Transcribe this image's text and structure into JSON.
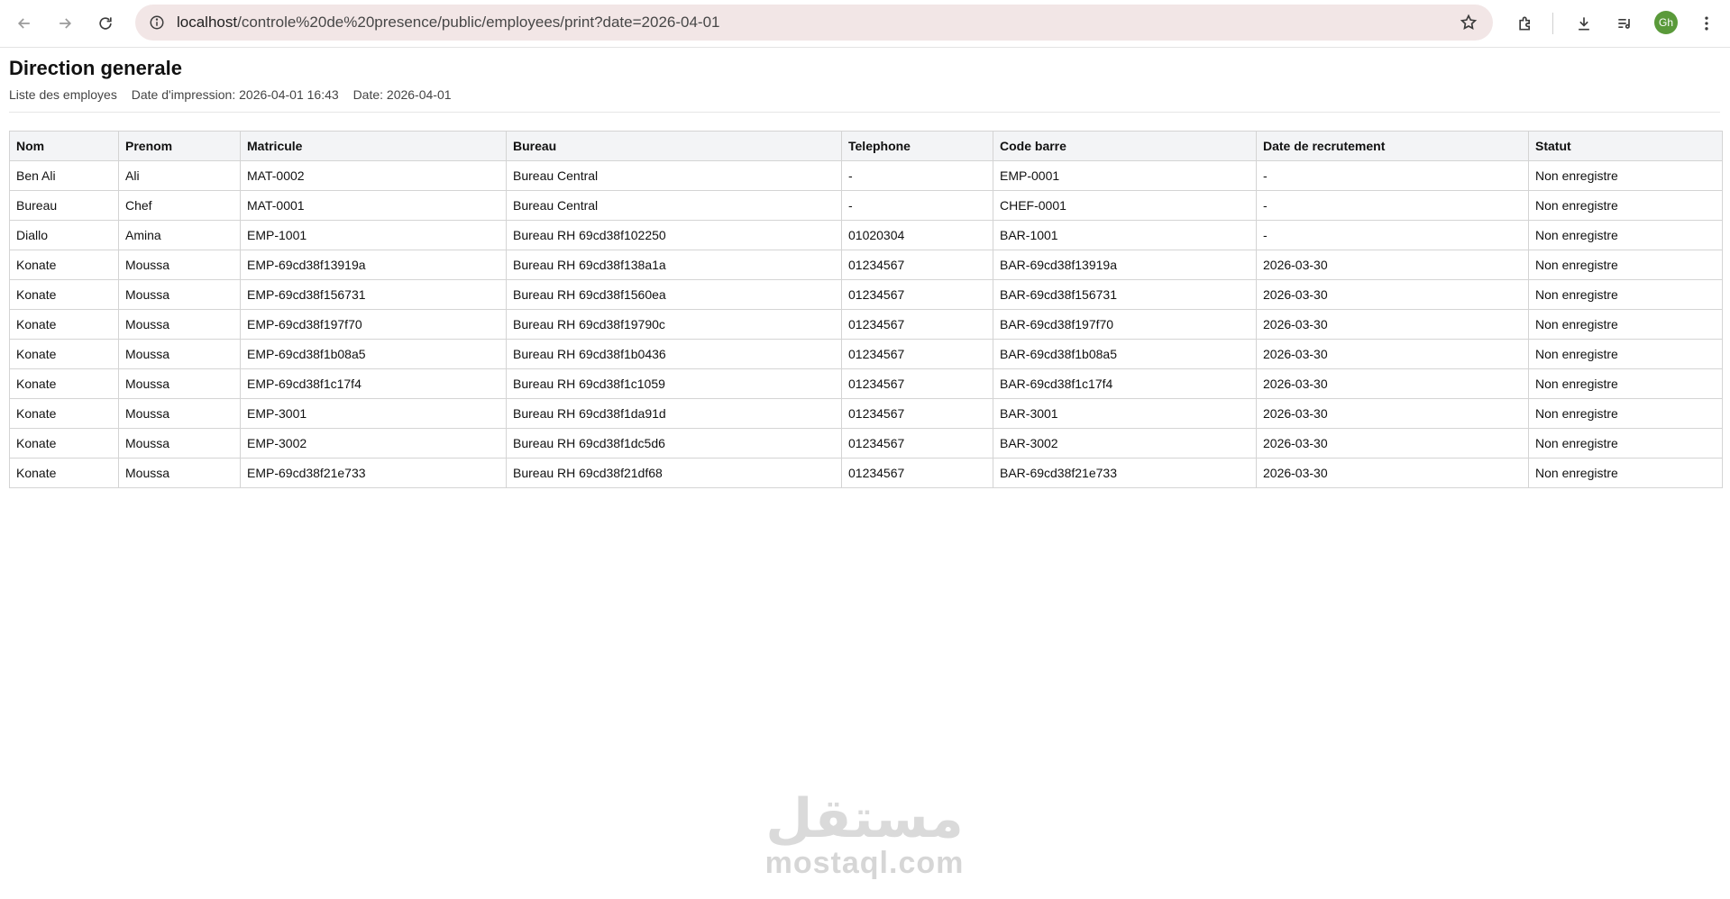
{
  "browser": {
    "url_host": "localhost",
    "url_path": "/controle%20de%20presence/public/employees/print?date=2026-04-01",
    "profile_initials": "Gh",
    "icons": [
      "back-icon",
      "forward-icon",
      "reload-icon",
      "site-info-icon",
      "star-icon",
      "extensions-icon",
      "download-icon",
      "media-icon",
      "menu-icon"
    ]
  },
  "page": {
    "title": "Direction generale",
    "subtitle": "Liste des employes",
    "printed_at": "Date d'impression: 2026-04-01 16:43",
    "date": "Date: 2026-04-01"
  },
  "table": {
    "columns": [
      "Nom",
      "Prenom",
      "Matricule",
      "Bureau",
      "Telephone",
      "Code barre",
      "Date de recrutement",
      "Statut"
    ],
    "rows": [
      [
        "Ben Ali",
        "Ali",
        "MAT-0002",
        "Bureau Central",
        "-",
        "EMP-0001",
        "-",
        "Non enregistre"
      ],
      [
        "Bureau",
        "Chef",
        "MAT-0001",
        "Bureau Central",
        "-",
        "CHEF-0001",
        "-",
        "Non enregistre"
      ],
      [
        "Diallo",
        "Amina",
        "EMP-1001",
        "Bureau RH 69cd38f102250",
        "01020304",
        "BAR-1001",
        "-",
        "Non enregistre"
      ],
      [
        "Konate",
        "Moussa",
        "EMP-69cd38f13919a",
        "Bureau RH 69cd38f138a1a",
        "01234567",
        "BAR-69cd38f13919a",
        "2026-03-30",
        "Non enregistre"
      ],
      [
        "Konate",
        "Moussa",
        "EMP-69cd38f156731",
        "Bureau RH 69cd38f1560ea",
        "01234567",
        "BAR-69cd38f156731",
        "2026-03-30",
        "Non enregistre"
      ],
      [
        "Konate",
        "Moussa",
        "EMP-69cd38f197f70",
        "Bureau RH 69cd38f19790c",
        "01234567",
        "BAR-69cd38f197f70",
        "2026-03-30",
        "Non enregistre"
      ],
      [
        "Konate",
        "Moussa",
        "EMP-69cd38f1b08a5",
        "Bureau RH 69cd38f1b0436",
        "01234567",
        "BAR-69cd38f1b08a5",
        "2026-03-30",
        "Non enregistre"
      ],
      [
        "Konate",
        "Moussa",
        "EMP-69cd38f1c17f4",
        "Bureau RH 69cd38f1c1059",
        "01234567",
        "BAR-69cd38f1c17f4",
        "2026-03-30",
        "Non enregistre"
      ],
      [
        "Konate",
        "Moussa",
        "EMP-3001",
        "Bureau RH 69cd38f1da91d",
        "01234567",
        "BAR-3001",
        "2026-03-30",
        "Non enregistre"
      ],
      [
        "Konate",
        "Moussa",
        "EMP-3002",
        "Bureau RH 69cd38f1dc5d6",
        "01234567",
        "BAR-3002",
        "2026-03-30",
        "Non enregistre"
      ],
      [
        "Konate",
        "Moussa",
        "EMP-69cd38f21e733",
        "Bureau RH 69cd38f21df68",
        "01234567",
        "BAR-69cd38f21e733",
        "2026-03-30",
        "Non enregistre"
      ]
    ]
  },
  "watermark": {
    "arabic": "مستقل",
    "latin": "mostaql.com"
  },
  "colors": {
    "omnibox_bg": "#f2e6e6",
    "header_bg": "#f3f4f6",
    "avatar_bg": "#5a9a3a",
    "border": "#d4d4d4"
  }
}
